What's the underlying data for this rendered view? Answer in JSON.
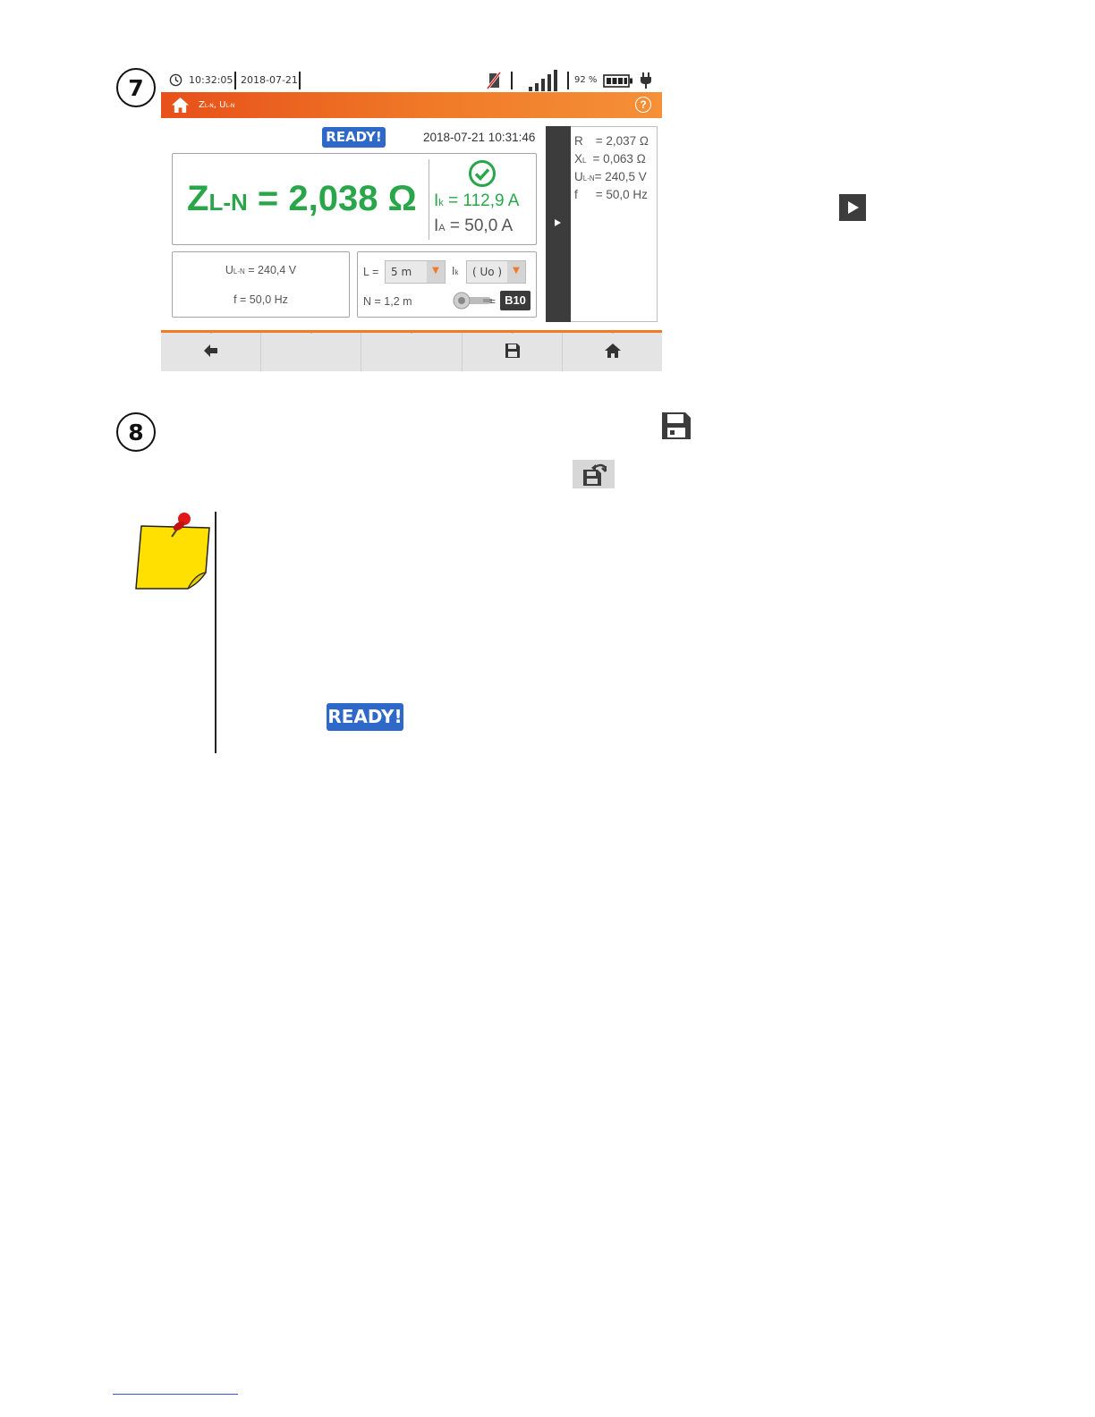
{
  "step7": {
    "number": "7",
    "status_bar": {
      "time": "10:32:05",
      "date": "2018-07-21",
      "battery": "92 %"
    },
    "title": {
      "main": "Z",
      "sub1": "L-N",
      "sep": ", U",
      "sub2": "L-N"
    },
    "ready": "READY!",
    "timestamp": "2018-07-21 10:31:46",
    "main_result": {
      "symbol": "Z",
      "subscript": "L-N",
      "value": "= 2,038 Ω"
    },
    "ik": {
      "symbol": "I",
      "subscript": "k",
      "value": "= 112,9 A"
    },
    "ia": {
      "symbol": "I",
      "subscript": "A",
      "value": "= 50,0 A"
    },
    "voltage": {
      "symbol": "U",
      "subscript": "L-N",
      "value": "= 240,4 V"
    },
    "frequency": "f = 50,0 Hz",
    "settings": {
      "l_label": "L =",
      "l_value": "5 m",
      "ik_symbol": "I",
      "ik_sub": "k",
      "ik_value": "( Uo )",
      "n_label": "N = 1,2 m",
      "eq": "=",
      "fuse": "B10"
    },
    "side_panel": {
      "r_label": "R",
      "r_value": "= 2,037 Ω",
      "xl_label": "X",
      "xl_sub": "L",
      "xl_value": "= 0,063 Ω",
      "u_label": "U",
      "u_sub": "L-N",
      "u_value": "= 240,5 V",
      "f_label": "f",
      "f_value": "= 50,0 Hz"
    }
  },
  "step8": {
    "number": "8"
  },
  "note": {
    "ready": "READY!"
  },
  "colors": {
    "accent": "#f07a28",
    "result_green": "#2aa64a",
    "ready_blue": "#2e68c9",
    "note_yellow": "#ffe000"
  }
}
